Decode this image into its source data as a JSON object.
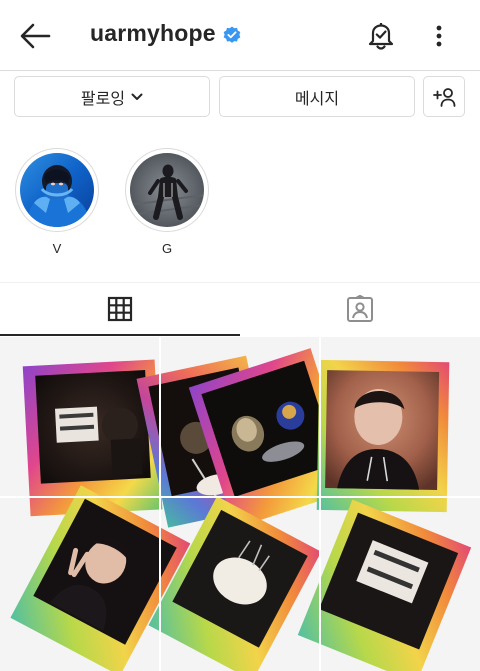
{
  "header": {
    "username": "uarmyhope",
    "verified": true,
    "icons": [
      "back-arrow-icon",
      "verified-badge-icon",
      "notification-bell-icon",
      "more-options-icon"
    ]
  },
  "actions": {
    "following_label": "팔로잉",
    "message_label": "메시지",
    "add_user_icon": "add-user-icon"
  },
  "highlights": [
    {
      "label": "V"
    },
    {
      "label": "G"
    }
  ],
  "tabs": [
    {
      "icon": "grid-icon",
      "active": true
    },
    {
      "icon": "tagged-icon",
      "active": false
    }
  ],
  "colors": {
    "text": "#262626",
    "border": "#dbdbdb",
    "verified": "#3897f0"
  }
}
